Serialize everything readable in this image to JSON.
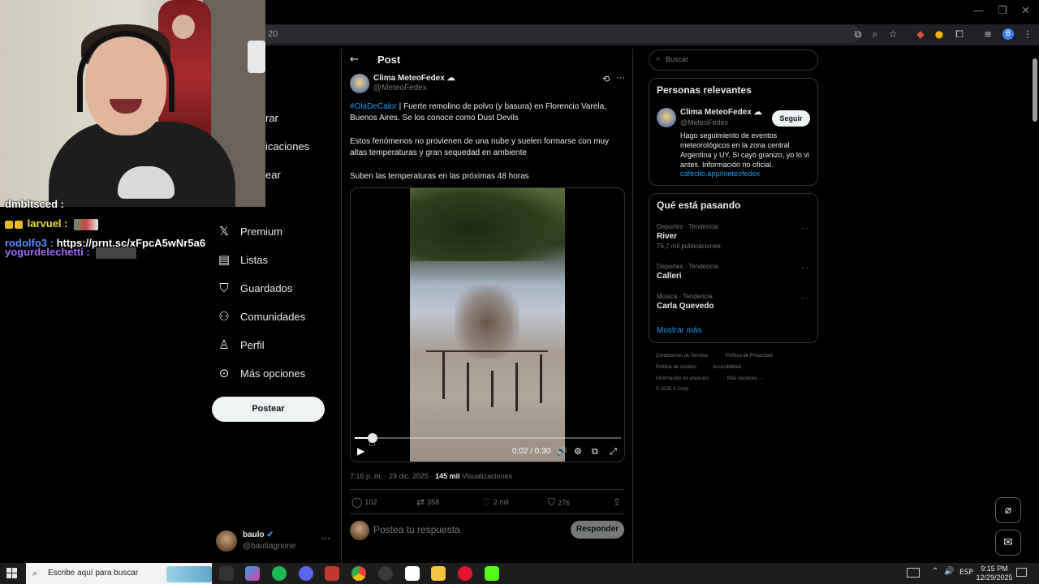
{
  "browser": {
    "url_fragment": "20"
  },
  "stream": {
    "chat": [
      {
        "user": "dmbltsced :",
        "color": "#ffffff",
        "text": ""
      },
      {
        "user": "larvuel :",
        "color": "#e8e230",
        "text": ""
      },
      {
        "user": "rodolfo3 :",
        "color": "#5b8cff",
        "text": "https://prnt.sc/xFpcA5wNr5a6"
      },
      {
        "user": "yogurdelechetti :",
        "color": "#9b6cff",
        "text": ""
      }
    ]
  },
  "nav": {
    "partial_items": [
      "rar",
      "icaciones",
      "ear"
    ],
    "items": [
      {
        "label": "Premium",
        "icon": "x-icon",
        "glyph": "X"
      },
      {
        "label": "Listas",
        "icon": "list-icon",
        "glyph": "☰"
      },
      {
        "label": "Guardados",
        "icon": "bookmark-icon",
        "glyph": "⚑"
      },
      {
        "label": "Comunidades",
        "icon": "communities-icon",
        "glyph": "⚇"
      },
      {
        "label": "Perfil",
        "icon": "profile-icon",
        "glyph": "♙"
      },
      {
        "label": "Más opciones",
        "icon": "more-circle-icon",
        "glyph": "⋯"
      }
    ],
    "post_button": "Postear",
    "account": {
      "name": "baulo",
      "handle": "@bautiagnone"
    }
  },
  "post": {
    "header_title": "Post",
    "author_name": "Clima MeteoFedex",
    "author_handle": "@MeteoFedex",
    "hashtag": "#OlaDeCalor",
    "line1_rest": " | Fuerte remolino de polvo (y basura) en Florencio Varela,",
    "line2": "Buenos Aires. Se los conoce como Dust Devils",
    "para2_line1": "Estos fenómenos no provienen de una nube y suelen formarse con muy",
    "para2_line2": "altas temperaturas y gran sequedad en ambiente",
    "para3": "Suben las temperaturas en las próximas 48 horas",
    "video": {
      "time": "0:02 / 0:30",
      "progress": 0.067
    },
    "timestamp": "7:16 p. m. · 29 dic. 2025 · ",
    "views_count": "145 mil",
    "views_label": " Visualizaciones",
    "replies": "102",
    "reposts": "358",
    "likes": "2 mil",
    "bookmarks": "276",
    "reply_placeholder": "Postea tu respuesta",
    "reply_button": "Responder"
  },
  "sidebar": {
    "search_placeholder": "Buscar",
    "relevant": {
      "title": "Personas relevantes",
      "name": "Clima MeteoFedex",
      "handle": "@MeteoFedex",
      "follow": "Seguir",
      "bio_lines": [
        "Hago seguimiento de eventos",
        "meteorológicos en la zona central",
        "Argentina y UY. Si cayó granizo, yo lo vi",
        "antes. Información no oficial."
      ],
      "link": "cafecito.app/meteofedex"
    },
    "trends": {
      "title": "Qué está pasando",
      "items": [
        {
          "meta": "Deportes · Tendencia",
          "name": "River",
          "count": "76,7 mil publicaciones"
        },
        {
          "meta": "Deportes · Tendencia",
          "name": "Calleri",
          "count": ""
        },
        {
          "meta": "Música · Tendencia",
          "name": "Carla Quevedo",
          "count": ""
        }
      ],
      "show_more": "Mostrar más"
    },
    "footer": {
      "row1": [
        "Condiciones de Servicio",
        "Política de Privacidad"
      ],
      "row2": [
        "Política de cookies",
        "Accesibilidad"
      ],
      "row3": [
        "Información de anuncios",
        "Más opciones ···"
      ],
      "copyright": "© 2025 X Corp."
    }
  },
  "taskbar": {
    "search_text": "Escribe aquí para buscar",
    "language": "ESP",
    "time": "9:15 PM",
    "date": "12/29/2025"
  }
}
